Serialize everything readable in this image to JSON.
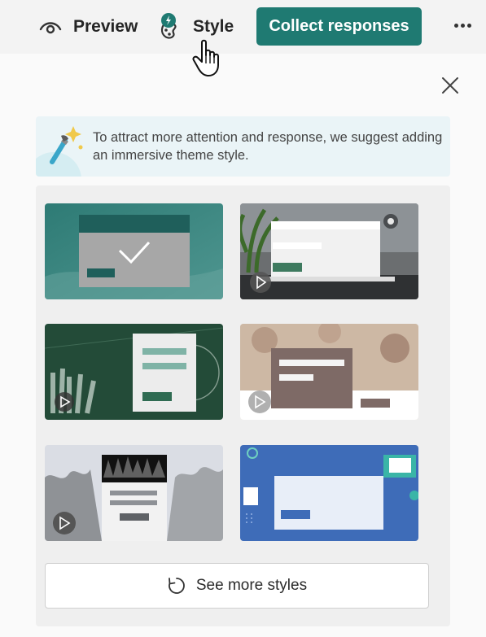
{
  "toolbar": {
    "preview_label": "Preview",
    "style_label": "Style",
    "collect_label": "Collect responses",
    "accent": "#1f7a72"
  },
  "tip": {
    "text": "To attract more attention and response, we suggest adding an immersive theme style."
  },
  "styles": [
    {
      "theme": "teal-checkmark",
      "video": false
    },
    {
      "theme": "office-desk-laptop",
      "video": true
    },
    {
      "theme": "chalkboard-books",
      "video": true
    },
    {
      "theme": "kids-drawing-table",
      "video": true
    },
    {
      "theme": "concert-crowd",
      "video": true
    },
    {
      "theme": "blue-study",
      "video": false
    }
  ],
  "see_more": {
    "label": "See more styles"
  }
}
